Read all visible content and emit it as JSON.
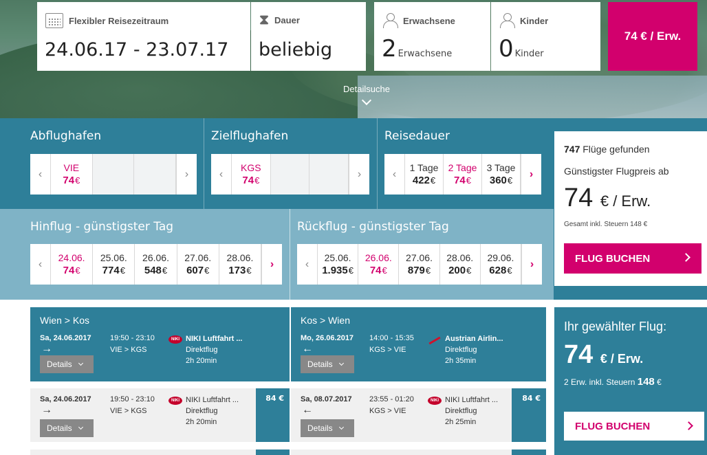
{
  "search": {
    "period_label": "Flexibler Reisezeitraum",
    "period_value": "24.06.17 - 23.07.17",
    "duration_label": "Dauer",
    "duration_value": "beliebig",
    "adults_label": "Erwachsene",
    "adults_count": "2",
    "adults_unit": "Erwachsene",
    "children_label": "Kinder",
    "children_count": "0",
    "children_unit": "Kinder",
    "price_button": "74 € / Erw.",
    "detail_search": "Detailsuche"
  },
  "filters": {
    "departure": {
      "title": "Abflughafen",
      "code": "VIE",
      "price": "74",
      "eur": "€"
    },
    "destination": {
      "title": "Zielflughafen",
      "code": "KGS",
      "price": "74",
      "eur": "€"
    },
    "duration": {
      "title": "Reisedauer",
      "options": [
        {
          "label": "1 Tage",
          "price": "422",
          "eur": "€"
        },
        {
          "label": "2 Tage",
          "price": "74",
          "eur": "€"
        },
        {
          "label": "3 Tage",
          "price": "360",
          "eur": "€"
        }
      ]
    },
    "outbound": {
      "title": "Hinflug - günstigster Tag",
      "days": [
        {
          "date": "24.06.",
          "price": "74",
          "eur": "€"
        },
        {
          "date": "25.06.",
          "price": "774",
          "eur": "€"
        },
        {
          "date": "26.06.",
          "price": "548",
          "eur": "€"
        },
        {
          "date": "27.06.",
          "price": "607",
          "eur": "€"
        },
        {
          "date": "28.06.",
          "price": "173",
          "eur": "€"
        }
      ]
    },
    "return": {
      "title": "Rückflug - günstigster Tag",
      "days": [
        {
          "date": "25.06.",
          "price": "1.935",
          "eur": "€"
        },
        {
          "date": "26.06.",
          "price": "74",
          "eur": "€"
        },
        {
          "date": "27.06.",
          "price": "879",
          "eur": "€"
        },
        {
          "date": "28.06.",
          "price": "200",
          "eur": "€"
        },
        {
          "date": "29.06.",
          "price": "628",
          "eur": "€"
        }
      ]
    }
  },
  "summary": {
    "count": "747",
    "found": "Flüge gefunden",
    "cheapest": "Günstigster Flugpreis ab",
    "price": "74",
    "per": "€ / Erw.",
    "total": "Gesamt inkl. Steuern 148 €",
    "book": "FLUG BUCHEN"
  },
  "selected_flights": {
    "outbound": {
      "route": "Wien > Kos",
      "date": "Sa, 24.06.2017",
      "arrow": "→",
      "time": "19:50 - 23:10",
      "airports": "VIE > KGS",
      "airline": "NIKI Luftfahrt ...",
      "type": "Direktflug",
      "duration": "2h 20min",
      "details": "Details",
      "logo": "NIKI"
    },
    "return": {
      "route": "Kos > Wien",
      "date": "Mo, 26.06.2017",
      "arrow": "←",
      "time": "14:00 - 15:35",
      "airports": "KGS > VIE",
      "airline": "Austrian Airlin...",
      "type": "Direktflug",
      "duration": "2h 35min",
      "details": "Details"
    }
  },
  "alternatives": {
    "outbound": {
      "date": "Sa, 24.06.2017",
      "arrow": "→",
      "time": "19:50 - 23:10",
      "airports": "VIE > KGS",
      "airline": "NIKI Luftfahrt ...",
      "type": "Direktflug",
      "duration": "2h 20min",
      "details": "Details",
      "price": "84 €",
      "logo": "NIKI"
    },
    "return": {
      "date": "Sa, 08.07.2017",
      "arrow": "←",
      "time": "23:55 - 01:20",
      "airports": "KGS > VIE",
      "airline": "NIKI Luftfahrt ...",
      "type": "Direktflug",
      "duration": "2h 25min",
      "details": "Details",
      "price": "84 €",
      "logo": "NIKI"
    }
  },
  "your_flight": {
    "title": "Ihr gewählter Flug:",
    "price": "74",
    "per": "€ / Erw.",
    "note": "2 Erw. inkl. Steuern",
    "total": "148",
    "eur": "€",
    "book": "FLUG BUCHEN"
  },
  "colors": {
    "accent": "#d2006d",
    "band": "#2e7f99",
    "band_light": "#7fb3c6"
  }
}
